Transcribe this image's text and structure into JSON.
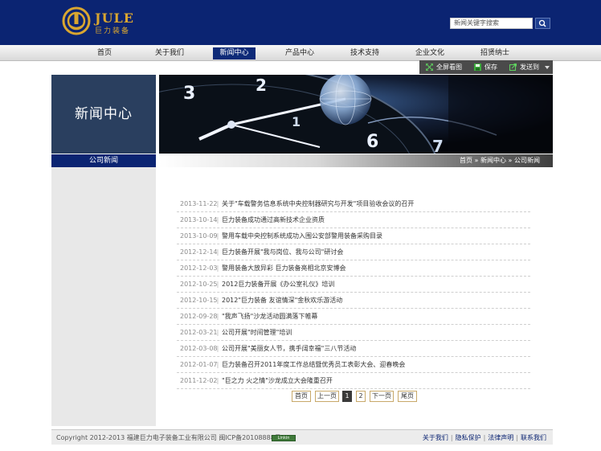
{
  "header": {
    "logo_en": "JULE",
    "logo_cn": "巨力装备",
    "search": {
      "value": "新闻关键字搜索"
    }
  },
  "nav": {
    "items": [
      {
        "label": "首页"
      },
      {
        "label": "关于我们"
      },
      {
        "label": "新闻中心"
      },
      {
        "label": "产品中心"
      },
      {
        "label": "技术支持"
      },
      {
        "label": "企业文化"
      },
      {
        "label": "招贤纳士"
      }
    ],
    "active": "新闻中心"
  },
  "toolbar": {
    "fullscreen": "全屏看图",
    "save": "保存",
    "send": "发送到"
  },
  "side": {
    "title": "新闻中心",
    "sub": "公司新闻"
  },
  "breadcrumb": {
    "home": "首页",
    "sep": "»",
    "section": "新闻中心",
    "page": "公司新闻"
  },
  "news": [
    {
      "date": "2013-11-22",
      "title": "关于\"车载警务信息系统中央控制器研究与开发\"项目验收会议的召开"
    },
    {
      "date": "2013-10-14",
      "title": "巨力装备成功通过高新技术企业资质"
    },
    {
      "date": "2013-10-09",
      "title": "警用车载中央控制系统成功入围公安部警用装备采购目录"
    },
    {
      "date": "2012-12-14",
      "title": "巨力装备开展\"我与岗位、我与公司\"研讨会"
    },
    {
      "date": "2012-12-03",
      "title": "警用装备大放异彩 巨力装备亮相北京安博会"
    },
    {
      "date": "2012-10-25",
      "title": "2012巨力装备开展《办公室礼仪》培训"
    },
    {
      "date": "2012-10-15",
      "title": "2012\"巨力装备 友谊情深\"金秋欢乐游活动"
    },
    {
      "date": "2012-09-28",
      "title": "\"我声飞扬\"沙龙活动圆满落下帷幕"
    },
    {
      "date": "2012-03-21",
      "title": "公司开展\"时间管理\"培训"
    },
    {
      "date": "2012-03-08",
      "title": "公司开展\"美丽女人节，携手阔幸福\"三八节活动"
    },
    {
      "date": "2012-01-07",
      "title": "巨力装备召开2011年度工作总结暨优秀员工表彰大会、迎春晚会"
    },
    {
      "date": "2011-12-02",
      "title": "\"巨之力 火之情\"沙龙成立大会隆重召开"
    }
  ],
  "pager": {
    "first": "首页",
    "prev": "上一页",
    "p1": "1",
    "p2": "2",
    "next": "下一页",
    "last": "尾页"
  },
  "footer": {
    "copyright": "Copyright  2012-2013  福建巨力电子装备工业有限公司   闽ICP备20108888号",
    "badge": "Linkin",
    "links": [
      {
        "label": "关于我们"
      },
      {
        "label": "隐私保护"
      },
      {
        "label": "法律声明"
      },
      {
        "label": "联系我们"
      }
    ],
    "sep": "|"
  },
  "colors": {
    "brand_navy": "#0b2472",
    "logo_gold": "#d9a630",
    "side_panel": "#2a3f5f",
    "toolbar": "#4a4a4a"
  },
  "icons": [
    "logo-mark-icon",
    "search-icon",
    "fullscreen-icon",
    "save-icon",
    "send-icon",
    "dropdown-arrow-icon"
  ]
}
